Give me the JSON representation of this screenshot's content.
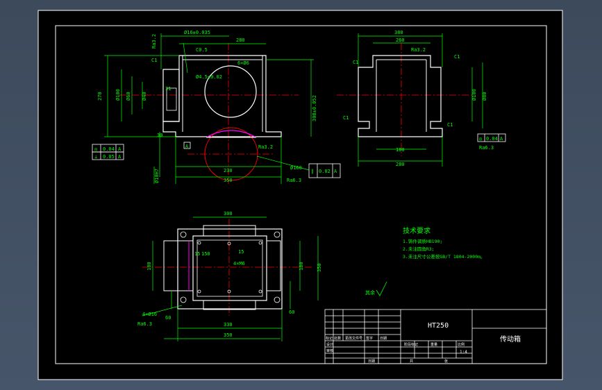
{
  "colors": {
    "paper": "#000000",
    "frame": "#ffffff",
    "dimension": "#00ff00",
    "outline": "#ffffff",
    "centerline": "#ff0000",
    "hidden": "#ff00ff",
    "text": "#ffffff",
    "notes": "#00ff00"
  },
  "front_view": {
    "dims": {
      "width_top": "280",
      "width_total": "350",
      "width_base": "230",
      "height": "270",
      "height_right": "308±0.052",
      "tol_top": "Ø16±0.035",
      "d_left1": "Ø100",
      "d_left2": "Ø60",
      "d_left3": "Ø40",
      "small1": "C0.5",
      "small2": "6×Ø6",
      "small3": "Ø4.5±0.02",
      "bottom_dim": "Ø10H7",
      "base_h": "30",
      "side": "31"
    },
    "labels": {
      "c1": "C1",
      "ra_top": "Ra3.2",
      "ra_right": "Ra3.2",
      "ra_bottom": "Ra6.3",
      "datum_a": "A",
      "tol_box1_a": "◎",
      "tol_box1_b": "0.04",
      "tol_box1_c": "A",
      "tol_box2_a": "⊥",
      "tol_box2_b": "0.05",
      "tol_box2_c": "A",
      "tol_box3_a": "∥",
      "tol_box3_b": "0.02",
      "tol_box3_c": "A",
      "bore": "Ø160"
    }
  },
  "side_view": {
    "dims": {
      "width_top": "380",
      "inner_top": "260",
      "width_bottom": "280",
      "inner_bottom": "180",
      "d_right1": "Ø100",
      "d_right2": "Ø80",
      "c1a": "C1",
      "c1b": "C1",
      "c1c": "C1",
      "c1d": "C1",
      "ra": "Ra3.2",
      "ra2": "Ra6.3",
      "tol_a": "◎",
      "tol_b": "0.04",
      "tol_c": "A"
    }
  },
  "top_view": {
    "dims": {
      "top": "300",
      "bottom1": "330",
      "bottom2": "350",
      "left": "180",
      "right1": "180",
      "right2": "350",
      "inner1": "15",
      "inner2": "4×M6",
      "holes": "4×Ø16",
      "ra": "Ra6.3",
      "right_small": "60",
      "left_small": "60",
      "mid1": "150",
      "mid2": "15"
    }
  },
  "notes": {
    "title": "技术要求",
    "lines": [
      "1.铸件调质HB190;",
      "2.未注圆角R3;",
      "3.未注尺寸公差按GB/T 1804-2000m。"
    ],
    "rest": "其余"
  },
  "title_block": {
    "material": "HT250",
    "part_name": "传动箱",
    "scale": "1:4",
    "row_labels": [
      "标记",
      "处数",
      "更改文件号",
      "签字",
      "日期"
    ],
    "design": "设计",
    "check": "审核",
    "stage": "阶段标记",
    "weight": "重量",
    "ratio": "比例",
    "sheet": "共",
    "page": "张",
    "date": "日期"
  }
}
